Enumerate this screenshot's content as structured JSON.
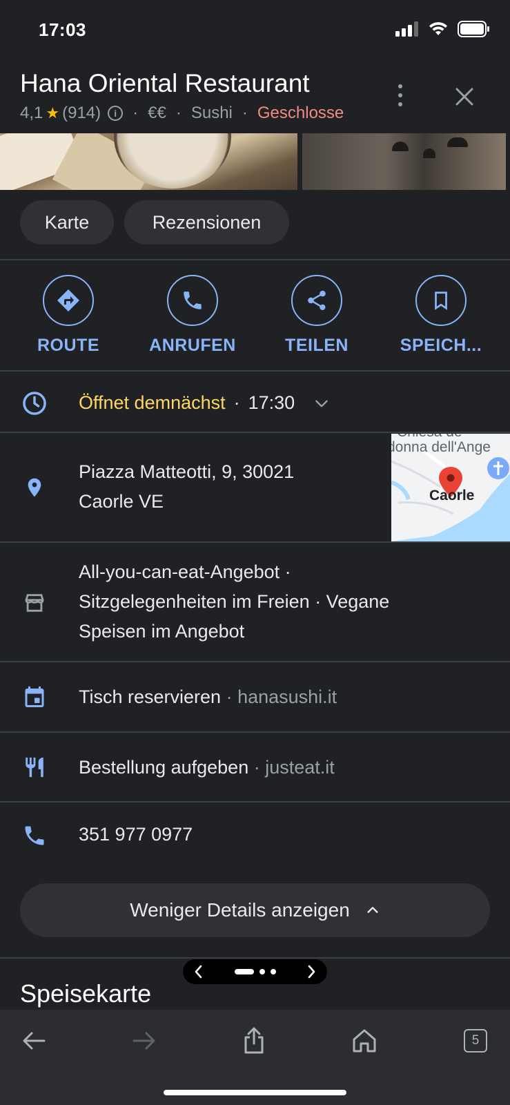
{
  "status_bar": {
    "time": "17:03"
  },
  "place": {
    "name": "Hana Oriental Restaurant",
    "rating": "4,1",
    "reviews_count": "(914)",
    "price": "€€",
    "category": "Sushi",
    "open_status": "Geschlosse"
  },
  "chips": {
    "map": "Karte",
    "reviews": "Rezensionen"
  },
  "actions": {
    "route": "ROUTE",
    "call": "ANRUFEN",
    "share": "TEILEN",
    "save": "SPEICH..."
  },
  "hours": {
    "status": "Öffnet demnächst",
    "sep": "·",
    "time": "17:30"
  },
  "address": {
    "line1": "Piazza Matteotti, 9, 30021",
    "line2": "Caorle VE"
  },
  "map": {
    "place_label": "Caorle",
    "top_label_1": "Chiesa de",
    "top_label_2": "donna dell'Ange"
  },
  "attributes": {
    "line1": "All-you-can-eat-Angebot ·",
    "line2": "Sitzgelegenheiten im Freien · Vegane",
    "line3": "Speisen im Angebot"
  },
  "reserve": {
    "label": "Tisch reservieren",
    "sep": " · ",
    "site": "hanasushi.it"
  },
  "order": {
    "label": "Bestellung aufgeben",
    "sep": " · ",
    "site": "justeat.it"
  },
  "phone": {
    "number": "351 977 0977"
  },
  "less_details": "Weniger Details anzeigen",
  "menu_heading": "Speisekarte",
  "toolbar": {
    "tabs_count": "5"
  },
  "colors": {
    "accent": "#8ab4f8",
    "closed": "#f28b82",
    "opening_soon": "#fdd663",
    "star": "#fbbc04"
  }
}
